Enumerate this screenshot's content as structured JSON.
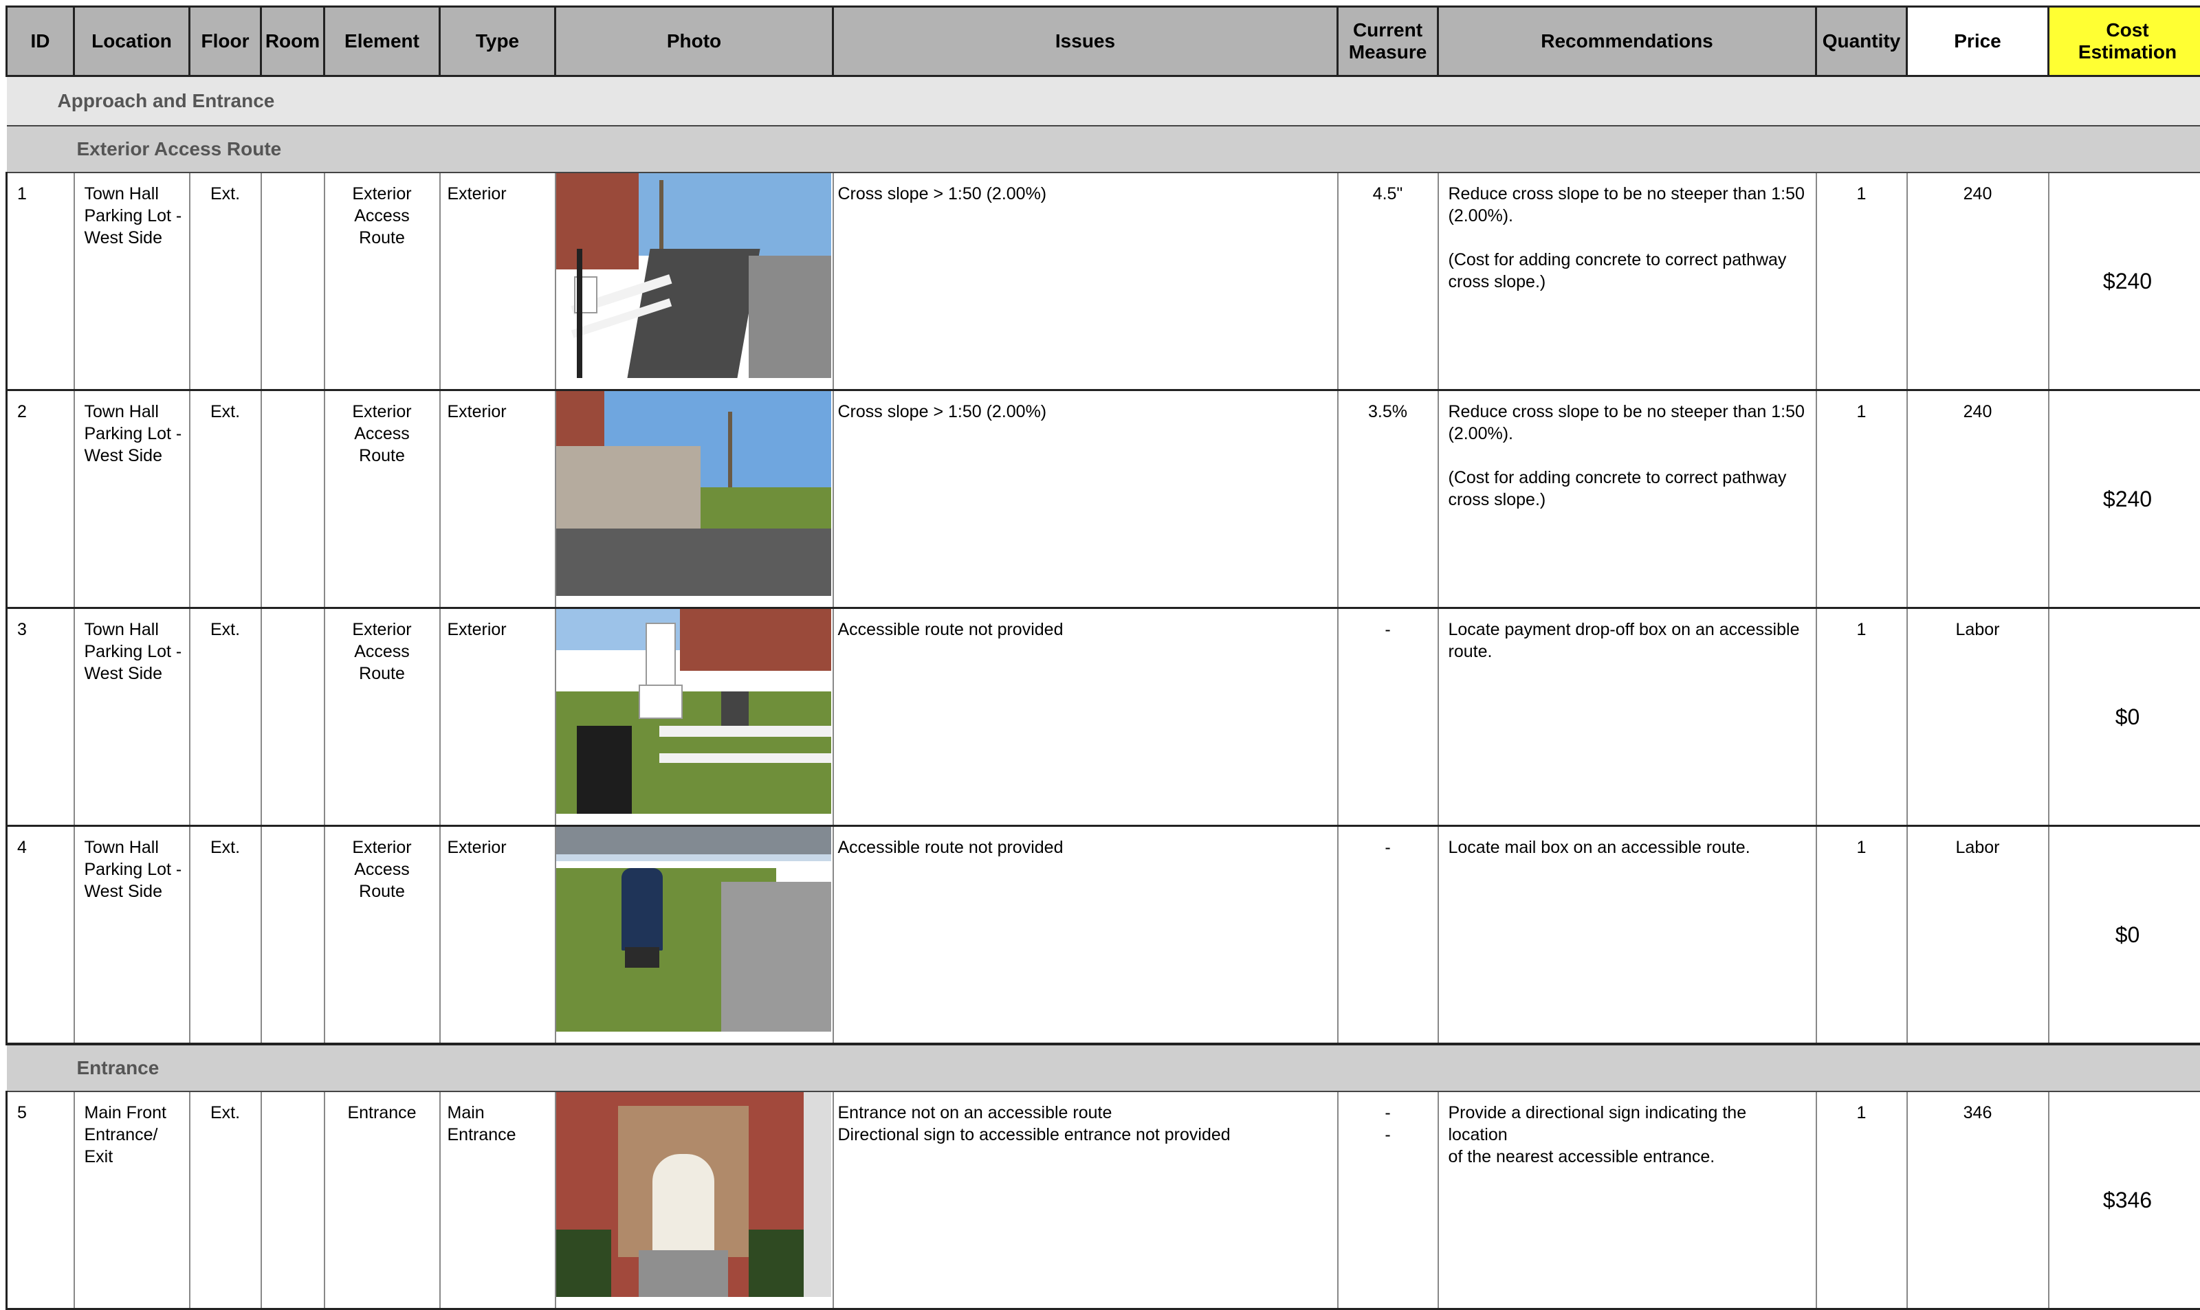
{
  "headers": {
    "id": "ID",
    "location": "Location",
    "floor": "Floor",
    "room": "Room",
    "element": "Element",
    "type": "Type",
    "photo": "Photo",
    "issues": "Issues",
    "current_measure_1": "Current",
    "current_measure_2": "Measure",
    "recommendations": "Recommendations",
    "quantity": "Quantity",
    "price": "Price",
    "cost_1": "Cost",
    "cost_2": "Estimation"
  },
  "sections": {
    "approach": "Approach and Entrance",
    "exterior_access_route": "Exterior Access Route",
    "entrance": "Entrance"
  },
  "rows": [
    {
      "id": "1",
      "location": [
        "Town Hall",
        "Parking Lot -",
        "West Side"
      ],
      "floor": "Ext.",
      "room": "",
      "element": [
        "Exterior",
        "Access",
        "Route"
      ],
      "type": [
        "Exterior"
      ],
      "issues": [
        "Cross slope > 1:50 (2.00%)"
      ],
      "measure": [
        "4.5\""
      ],
      "recommendation": [
        "Reduce cross slope to be no steeper than 1:50",
        "(2.00%)."
      ],
      "recommendation_note": [
        "(Cost for adding concrete to correct pathway",
        "cross slope.)"
      ],
      "quantity": "1",
      "price": "240",
      "cost": "$240",
      "photo_icon": "parking-lot-path-photo"
    },
    {
      "id": "2",
      "location": [
        "Town Hall",
        "Parking Lot -",
        "West Side"
      ],
      "floor": "Ext.",
      "room": "",
      "element": [
        "Exterior",
        "Access",
        "Route"
      ],
      "type": [
        "Exterior"
      ],
      "issues": [
        "Cross slope > 1:50 (2.00%)"
      ],
      "measure": [
        "3.5%"
      ],
      "recommendation": [
        "Reduce cross slope to be no steeper than 1:50",
        "(2.00%)."
      ],
      "recommendation_note": [
        "(Cost for adding concrete to correct pathway",
        "cross slope.)"
      ],
      "quantity": "1",
      "price": "240",
      "cost": "$240",
      "photo_icon": "fence-walkway-photo"
    },
    {
      "id": "3",
      "location": [
        "Town Hall",
        "Parking Lot -",
        "West Side"
      ],
      "floor": "Ext.",
      "room": "",
      "element": [
        "Exterior",
        "Access",
        "Route"
      ],
      "type": [
        "Exterior"
      ],
      "issues": [
        "Accessible route not provided"
      ],
      "measure": [
        "-"
      ],
      "recommendation": [
        "Locate payment drop-off box on an accessible",
        "route."
      ],
      "recommendation_note": [],
      "quantity": "1",
      "price": "Labor",
      "cost": "$0",
      "photo_icon": "drop-off-box-photo"
    },
    {
      "id": "4",
      "location": [
        "Town Hall",
        "Parking Lot -",
        "West Side"
      ],
      "floor": "Ext.",
      "room": "",
      "element": [
        "Exterior",
        "Access",
        "Route"
      ],
      "type": [
        "Exterior"
      ],
      "issues": [
        "Accessible route not provided"
      ],
      "measure": [
        "-"
      ],
      "recommendation": [
        "Locate mail box on an accessible route."
      ],
      "recommendation_note": [],
      "quantity": "1",
      "price": "Labor",
      "cost": "$0",
      "photo_icon": "mail-box-photo"
    },
    {
      "id": "5",
      "location": [
        "Main Front",
        "Entrance/",
        "Exit"
      ],
      "floor": "Ext.",
      "room": "",
      "element": [
        "Entrance"
      ],
      "type": [
        "Main",
        "Entrance"
      ],
      "issues": [
        "Entrance not on an accessible route",
        "Directional sign to accessible entrance not provided"
      ],
      "measure": [
        "-",
        "-"
      ],
      "recommendation": [
        "Provide a directional sign indicating the location",
        "of the nearest accessible entrance."
      ],
      "recommendation_note": [],
      "quantity": "1",
      "price": "346",
      "cost": "$346",
      "photo_icon": "main-entrance-photo"
    }
  ]
}
